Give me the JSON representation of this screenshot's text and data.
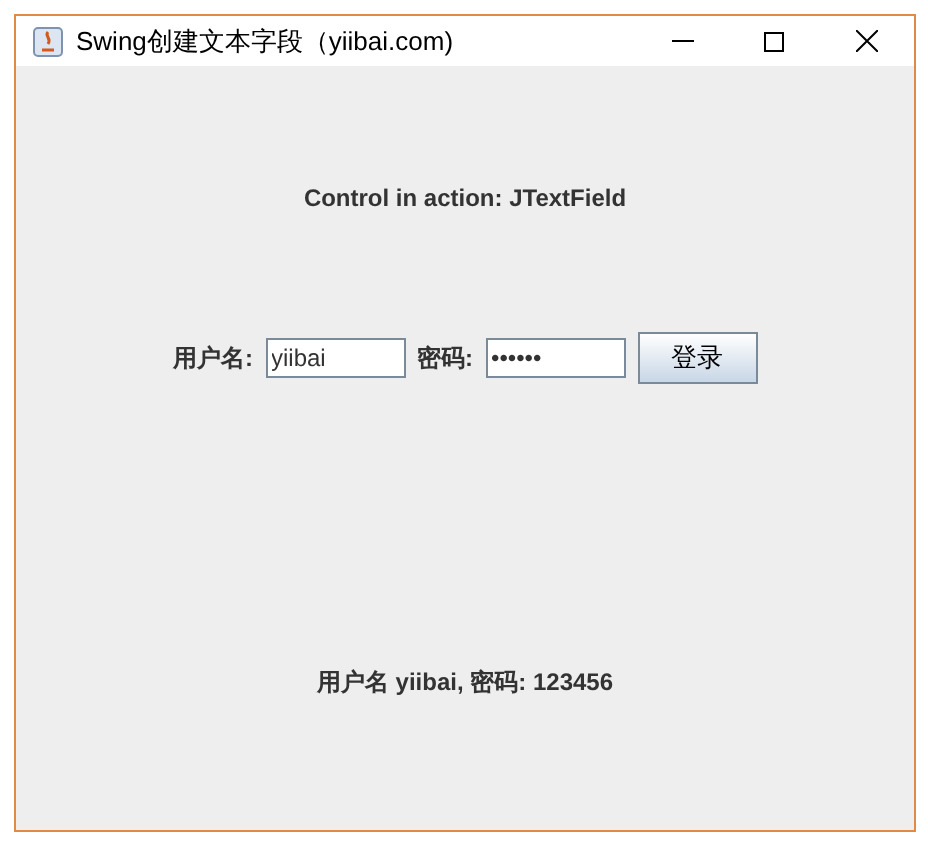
{
  "window": {
    "title": "Swing创建文本字段（yiibai.com)"
  },
  "header": "Control in action: JTextField",
  "form": {
    "username_label": "用户名:",
    "username_value": "yiibai",
    "password_label": "密码:",
    "password_value": "••••••",
    "login_button": "登录"
  },
  "status": "用户名 yiibai, 密码: 123456"
}
